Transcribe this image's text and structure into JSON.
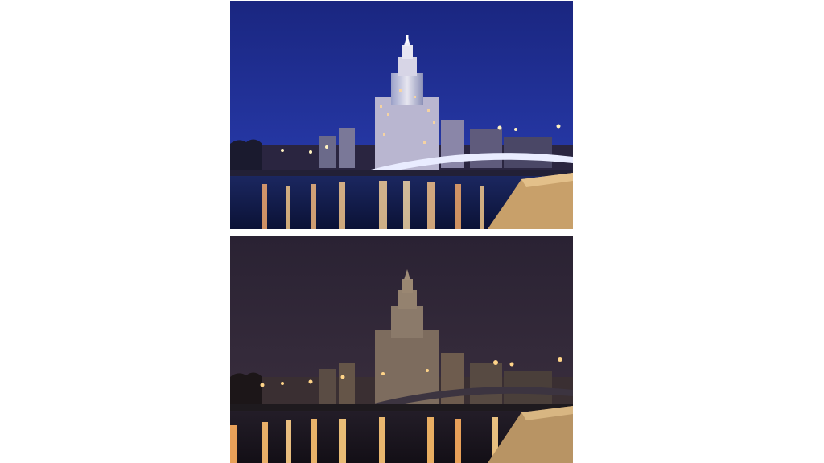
{
  "photos": [
    {
      "scene": "lights-on",
      "colors": {
        "sky_top": "#1d2a86",
        "sky_bottom": "#2a3faa",
        "water": "#0f1a4a"
      }
    },
    {
      "scene": "lights-off",
      "colors": {
        "sky_top": "#2b2432",
        "sky_bottom": "#3a2f3a",
        "water": "#1b1720"
      }
    }
  ]
}
